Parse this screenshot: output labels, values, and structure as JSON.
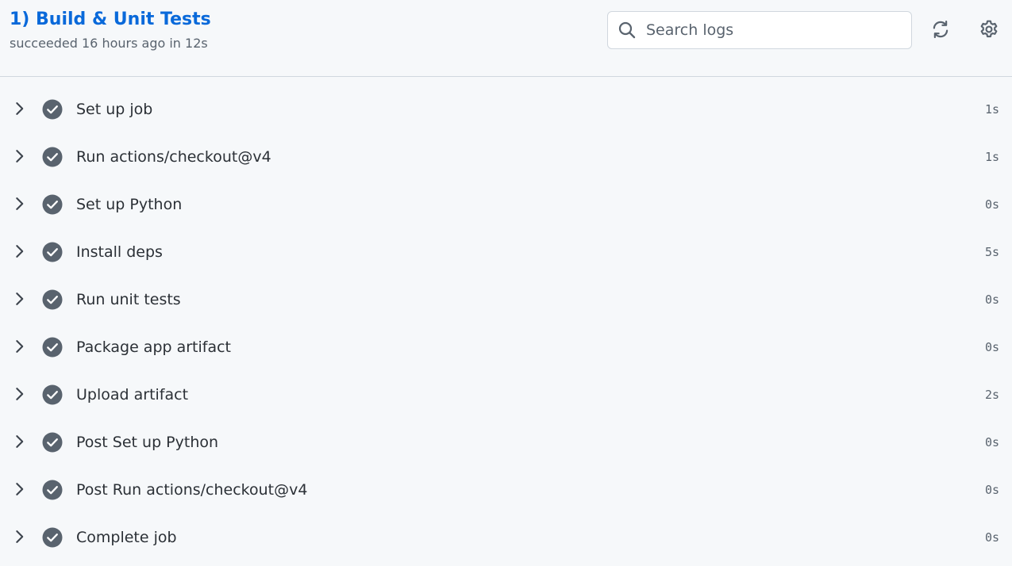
{
  "header": {
    "title": "1) Build & Unit Tests",
    "status": "succeeded 16 hours ago in 12s"
  },
  "search": {
    "placeholder": "Search logs",
    "icon": "search-icon"
  },
  "toolbar": {
    "refresh_icon": "refresh-icon",
    "settings_icon": "gear-icon"
  },
  "colors": {
    "title": "#0969da",
    "check": "#59636e",
    "background": "#f6f8fa"
  },
  "steps": [
    {
      "name": "Set up job",
      "duration": "1s",
      "status": "success"
    },
    {
      "name": "Run actions/checkout@v4",
      "duration": "1s",
      "status": "success"
    },
    {
      "name": "Set up Python",
      "duration": "0s",
      "status": "success"
    },
    {
      "name": "Install deps",
      "duration": "5s",
      "status": "success"
    },
    {
      "name": "Run unit tests",
      "duration": "0s",
      "status": "success"
    },
    {
      "name": "Package app artifact",
      "duration": "0s",
      "status": "success"
    },
    {
      "name": "Upload artifact",
      "duration": "2s",
      "status": "success"
    },
    {
      "name": "Post Set up Python",
      "duration": "0s",
      "status": "success"
    },
    {
      "name": "Post Run actions/checkout@v4",
      "duration": "0s",
      "status": "success"
    },
    {
      "name": "Complete job",
      "duration": "0s",
      "status": "success"
    }
  ]
}
